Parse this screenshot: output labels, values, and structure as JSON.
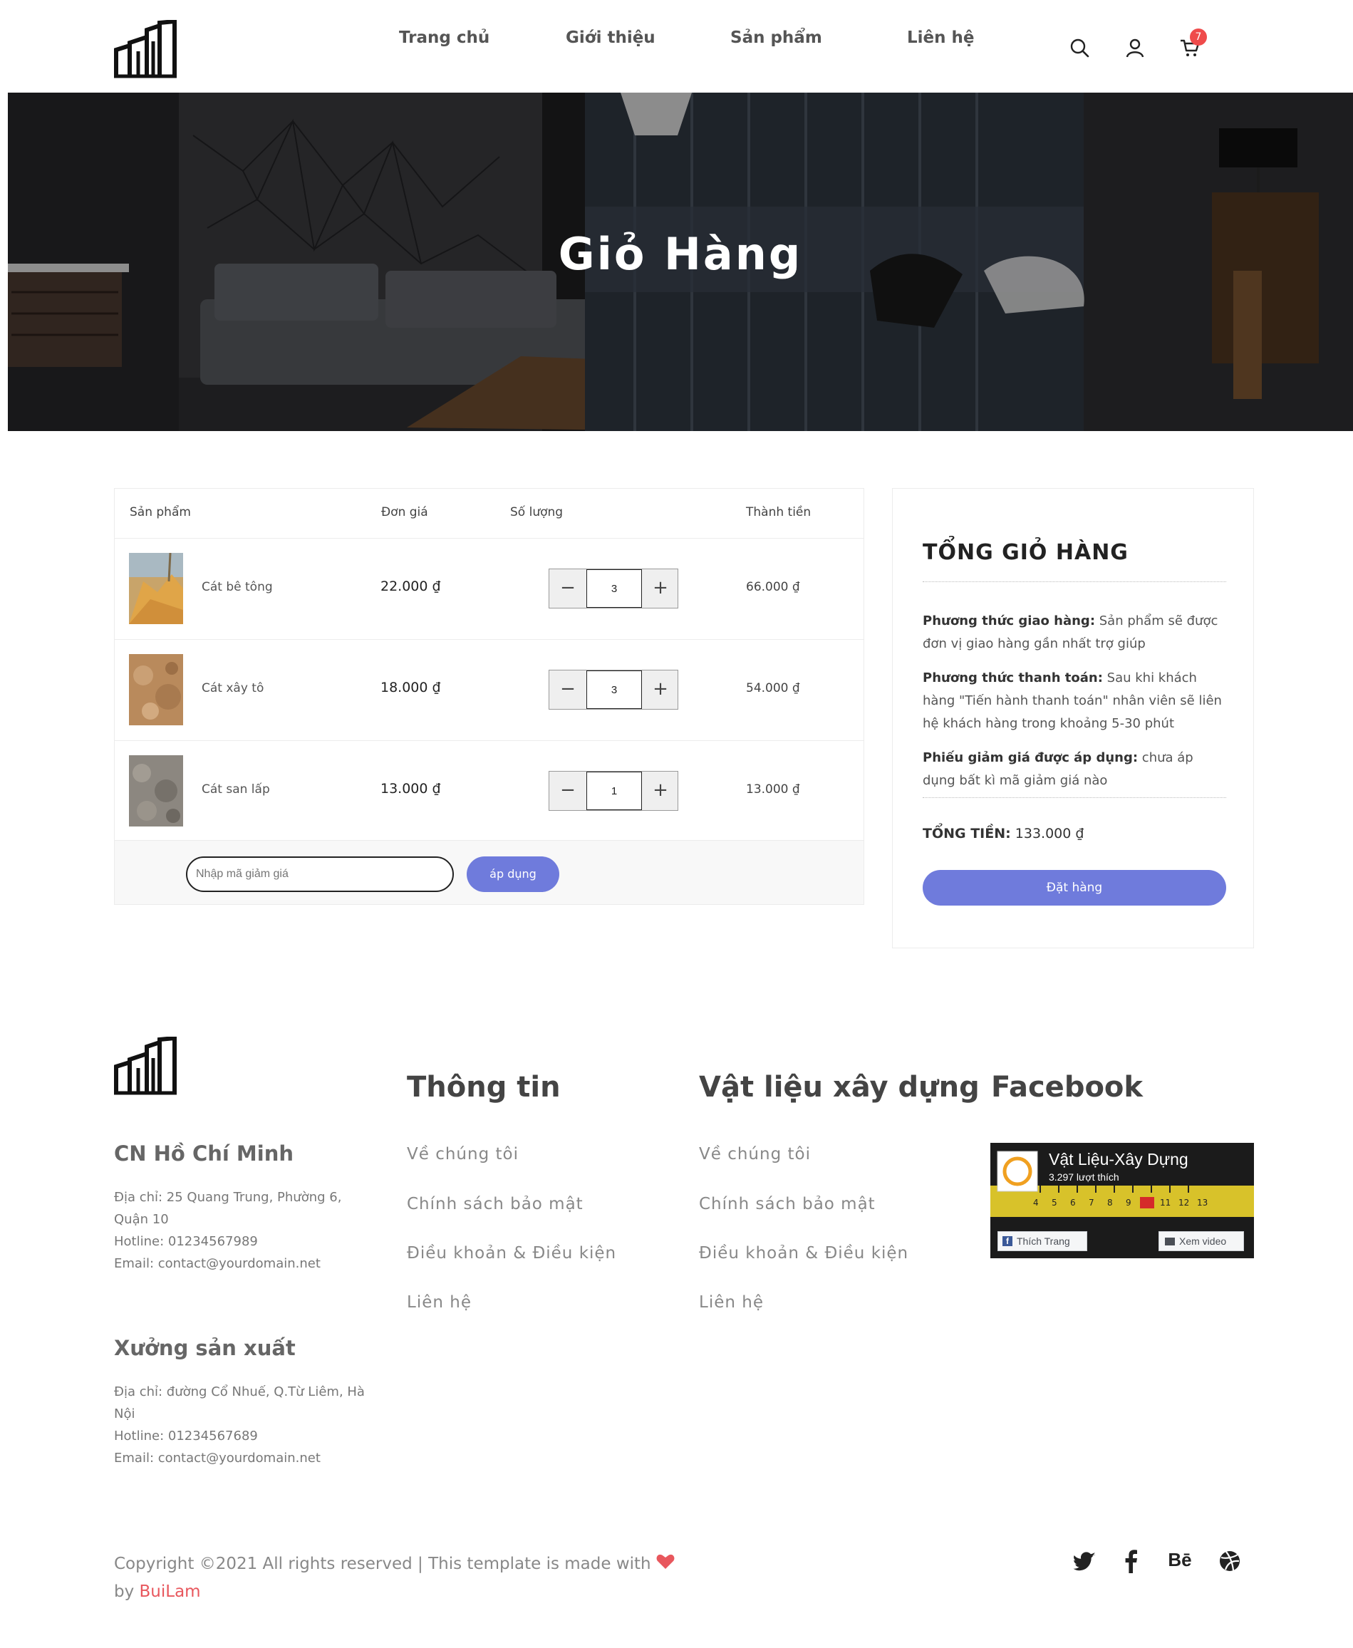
{
  "header": {
    "nav": [
      {
        "label": "Trang chủ"
      },
      {
        "label": "Giới thiệu"
      },
      {
        "label": "Sản phẩm"
      },
      {
        "label": "Liên hệ"
      }
    ],
    "icons": [
      "search-icon",
      "user-icon",
      "cart-icon"
    ],
    "cart_count": "7"
  },
  "banner": {
    "title": "Giỏ Hàng"
  },
  "cart": {
    "headers": {
      "product": "Sản phẩm",
      "price": "Đơn giá",
      "quantity": "Số lượng",
      "subtotal": "Thành tiền"
    },
    "items": [
      {
        "name": "Cát bê tông",
        "price": "22.000 ₫",
        "quantity": "3",
        "subtotal": "66.000 ₫"
      },
      {
        "name": "Cát xây tô",
        "price": "18.000 ₫",
        "quantity": "3",
        "subtotal": "54.000 ₫"
      },
      {
        "name": "Cát san lấp",
        "price": "13.000 ₫",
        "quantity": "1",
        "subtotal": "13.000 ₫"
      }
    ],
    "minus_symbol": "−",
    "plus_symbol": "+",
    "coupon": {
      "placeholder": "Nhập mã giảm giá",
      "button": "áp dụng"
    }
  },
  "summary": {
    "title": "TỔNG GIỎ HÀNG",
    "shipping_label": "Phương thức giao hàng:",
    "shipping_text": "Sản phẩm sẽ được đơn vị giao hàng gần nhất trợ giúp",
    "payment_label": "Phương thức thanh toán:",
    "payment_text": "Sau khi khách hàng \"Tiến hành thanh toán\" nhân viên sẽ liên hệ khách hàng trong khoảng 5-30 phút",
    "coupon_label": "Phiếu giảm giá được áp dụng:",
    "coupon_text": "chưa áp dụng bất kì mã giảm giá nào",
    "total_label": "TỔNG TIỀN:",
    "total_value": "133.000 ₫",
    "order_button": "Đặt hàng"
  },
  "footer": {
    "branch1": {
      "title": "CN Hồ Chí Minh",
      "address": "Địa chỉ: 25 Quang Trung, Phường 6, Quận 10",
      "hotline": "Hotline: 01234567989",
      "email": "Email: contact@yourdomain.net"
    },
    "branch2": {
      "title": "Xưởng sản xuất",
      "address": "Địa chỉ: đường Cổ Nhuế, Q.Từ Liêm, Hà Nội",
      "hotline": "Hotline: 01234567689",
      "email": "Email: contact@yourdomain.net"
    },
    "col_info": {
      "title": "Thông tin",
      "links": [
        "Về chúng tôi",
        "Chính sách bảo mật",
        "Điều khoản & Điều kiện",
        "Liên hệ"
      ]
    },
    "col_materials": {
      "title": "Vật liệu xây dựng",
      "links": [
        "Về chúng tôi",
        "Chính sách bảo mật",
        "Điều khoản & Điều kiện",
        "Liên hệ"
      ]
    },
    "col_facebook": {
      "title": "Facebook",
      "page_name": "Vật Liệu-Xây Dựng",
      "likes": "3.297 lượt thích",
      "like_button": "Thích Trang",
      "video_button": "Xem video"
    },
    "copyright_text": "Copyright ©2021 All rights reserved | This template is made with",
    "copyright_by": "by",
    "copyright_author": "BuiLam",
    "social": [
      "twitter-icon",
      "facebook-icon",
      "behance-icon",
      "dribbble-icon"
    ],
    "behance_text": "Bē"
  },
  "colors": {
    "accent": "#6f7bdc",
    "badge": "#ef4b4b",
    "heart": "#e8575d"
  }
}
